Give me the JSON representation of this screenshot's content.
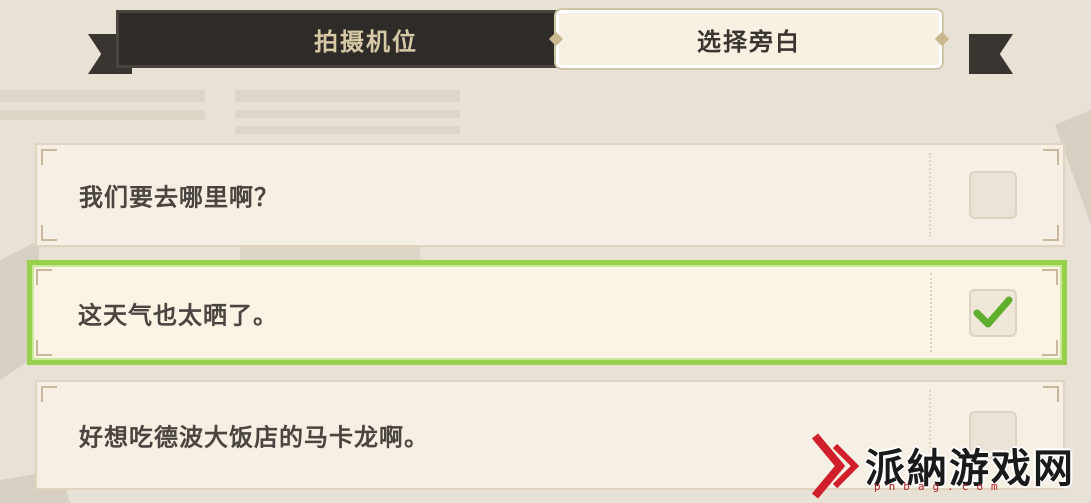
{
  "tabs": [
    {
      "label": "拍摄机位",
      "active": false
    },
    {
      "label": "选择旁白",
      "active": true
    }
  ],
  "options": [
    {
      "text": "我们要去哪里啊？",
      "checked": false
    },
    {
      "text": "这天气也太晒了。",
      "checked": true
    },
    {
      "text": "好想吃德波大饭店的马卡龙啊。",
      "checked": false
    }
  ],
  "watermark": {
    "title": "派納游戏网",
    "sub": "pnbag.com"
  },
  "colors": {
    "accent_green": "#9ad14a",
    "check_green": "#5fae2e",
    "tab_dark": "#2f2b28"
  }
}
